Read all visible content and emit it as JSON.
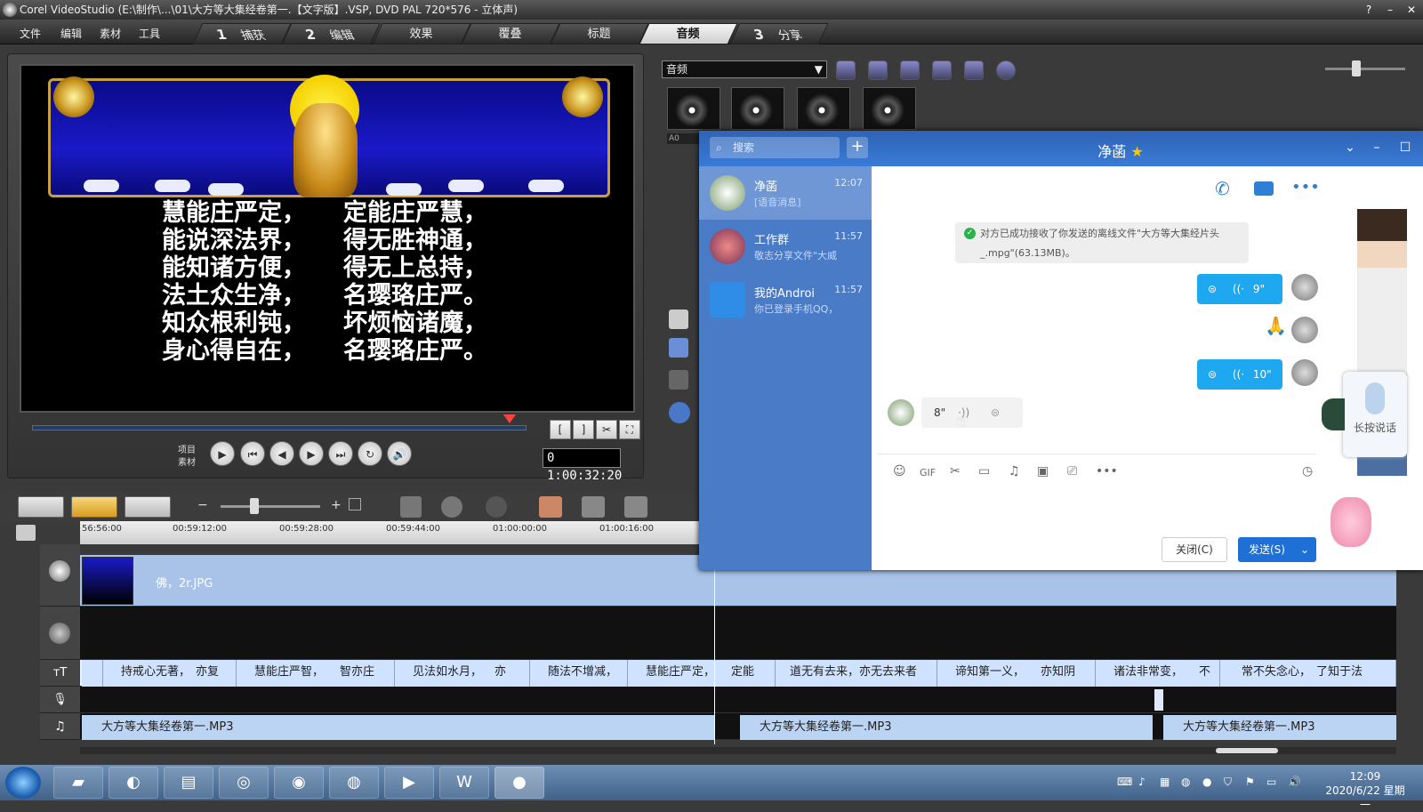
{
  "window": {
    "title": "Corel VideoStudio (E:\\制作\\...\\01\\大方等大集经卷第一.【文字版】.VSP, DVD PAL 720*576 - 立体声)",
    "help": "?",
    "minimize": "–",
    "close": "✕"
  },
  "menu": [
    "文件",
    "编辑",
    "素材",
    "工具"
  ],
  "steps": [
    {
      "num": "1",
      "label": "捕获"
    },
    {
      "num": "2",
      "label": "编辑"
    },
    {
      "num": "",
      "label": "效果"
    },
    {
      "num": "",
      "label": "覆叠"
    },
    {
      "num": "",
      "label": "标题"
    },
    {
      "num": "",
      "label": "音频"
    },
    {
      "num": "3",
      "label": "分享"
    }
  ],
  "preview": {
    "lines": [
      [
        "慧能庄严定，",
        "定能庄严慧，"
      ],
      [
        "能说深法界，",
        "得无胜神通，"
      ],
      [
        "能知诸方便，",
        "得无上总持，"
      ],
      [
        "法土众生净，",
        "名璎珞庄严。"
      ],
      [
        "知众根利钝，",
        "坏烦恼诸魔，"
      ],
      [
        "身心得自在，",
        "名璎珞庄严。"
      ]
    ],
    "mode_project": "项目",
    "mode_clip": "素材",
    "timecode": "0 1:00:32:20",
    "trim_start": "[",
    "trim_end": "]",
    "split": "✂",
    "snapshot": "⛶"
  },
  "library": {
    "category": "音频",
    "clip_label": "A0"
  },
  "ruler": [
    "56:56:00",
    "00:59:12:00",
    "00:59:28:00",
    "00:59:44:00",
    "01:00:00:00",
    "01:00:16:00"
  ],
  "timeline": {
    "video_clip": "佛，2r.JPG",
    "title_clips": [
      "",
      "持戒心无著，",
      "亦复",
      "慧能庄严智，",
      "智亦庄",
      "见法如水月，",
      "亦",
      "随法不增减，",
      "慧能庄严定，",
      "定能",
      "道无有去来，",
      "亦无去来者",
      "谛知第一义，",
      "亦知阴",
      "诸法非常变，",
      "不",
      "常不失念心，",
      "了知于法"
    ],
    "music_clips": [
      "大方等大集经卷第一.MP3",
      "大方等大集经卷第一.MP3",
      "大方等大集经卷第一.MP3"
    ]
  },
  "qq": {
    "search_placeholder": "搜索",
    "add": "+",
    "title": "净菡",
    "star": "★",
    "contacts": [
      {
        "name": "净菡",
        "time": "12:07",
        "preview": "[语音消息]"
      },
      {
        "name": "工作群",
        "time": "11:57",
        "preview": "敬志分享文件\"大威"
      },
      {
        "name": "我的Androi",
        "time": "11:57",
        "preview": "你已登录手机QQ，"
      }
    ],
    "system_message": "对方已成功接收了你发送的离线文件\"大方等大集经片头_.mpg\"(63.13MB)。",
    "voice_out_1": "9\"",
    "voice_out_2": "10\"",
    "emoji_reply": "🙏",
    "voice_in": "8\"",
    "close_button": "关闭(C)",
    "send_button": "发送(S)",
    "mic_label": "长按说话",
    "colors": {
      "header": "#3a7bd6",
      "bubble": "#1ea8f0",
      "send": "#1e6fd6"
    }
  },
  "taskbar": {
    "time": "12:09",
    "date": "2020/6/22 星期一"
  }
}
